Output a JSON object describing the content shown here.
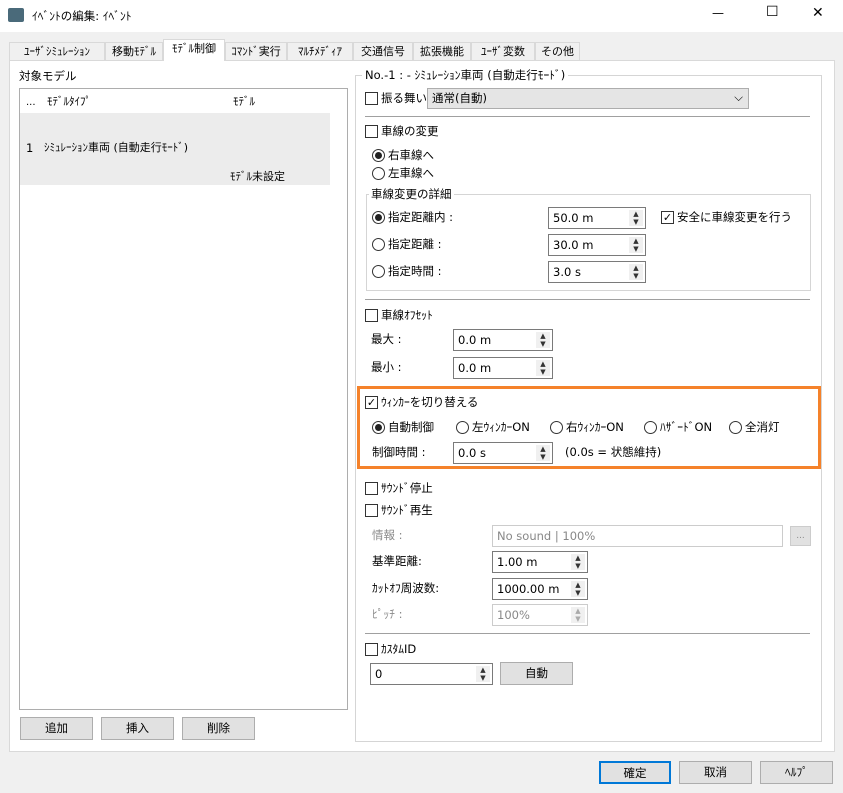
{
  "window": {
    "title": "ｲﾍﾞﾝﾄの編集: ｲﾍﾞﾝﾄ",
    "minimize": "—",
    "maximize": "☐",
    "close": "✕"
  },
  "tabs": [
    "ﾕｰｻﾞｼﾐｭﾚｰｼｮﾝ",
    "移動ﾓﾃﾞﾙ",
    "ﾓﾃﾞﾙ制御",
    "ｺﾏﾝﾄﾞ実行",
    "ﾏﾙﾁﾒﾃﾞｨｱ",
    "交通信号",
    "拡張機能",
    "ﾕｰｻﾞ変数",
    "その他"
  ],
  "active_tab": "ﾓﾃﾞﾙ制御",
  "left": {
    "label": "対象モデル",
    "columns": [
      "...",
      "ﾓﾃﾞﾙﾀｲﾌﾟ",
      "ﾓﾃﾞﾙ"
    ],
    "rows": [
      {
        "no": "1",
        "type": "ｼﾐｭﾚｰｼｮﾝ車両 (自動走行ﾓｰﾄﾞ)",
        "model": "ﾓﾃﾞﾙ未設定"
      }
    ],
    "buttons": {
      "add": "追加",
      "insert": "挿入",
      "delete": "削除"
    }
  },
  "right": {
    "group_title": "No.-1 : - ｼﾐｭﾚｰｼｮﾝ車両 (自動走行ﾓｰﾄﾞ)",
    "behavior": {
      "label": "振る舞い",
      "checked": false,
      "value": "通常(自動)"
    },
    "lane_change": {
      "label": "車線の変更",
      "checked": false,
      "right": "右車線へ",
      "left": "左車線へ",
      "selected": "right",
      "detail_title": "車線変更の詳細",
      "within_distance": "指定距離内 :",
      "within_value": "50.0 m",
      "distance": "指定距離 :",
      "distance_value": "30.0 m",
      "time": "指定時間 :",
      "time_value": "3.0 s",
      "safe": "安全に車線変更を行う",
      "safe_checked": true
    },
    "lane_offset": {
      "label": "車線ｵﾌｾｯﾄ",
      "checked": false,
      "max_label": "最大 :",
      "max_value": "0.0 m",
      "min_label": "最小 :",
      "min_value": "0.0 m"
    },
    "winker": {
      "label": "ｳｨﾝｶｰを切り替える",
      "checked": true,
      "options": [
        "自動制御",
        "左ｳｨﾝｶｰON",
        "右ｳｨﾝｶｰON",
        "ﾊｻﾞｰﾄﾞON",
        "全消灯"
      ],
      "selected": 0,
      "time_label": "制御時間 :",
      "time_value": "0.0 s",
      "note": "(0.0s = 状態維持)",
      "highlight_color": "#f5822a"
    },
    "sound_stop": {
      "label": "ｻｳﾝﾄﾞ停止",
      "checked": false
    },
    "sound_play": {
      "label": "ｻｳﾝﾄﾞ再生",
      "checked": false,
      "info_label": "情報 :",
      "info_value": "No sound | 100%",
      "browse": "...",
      "ref_label": "基準距離:",
      "ref_value": "1.00 m",
      "cutoff_label": "ｶｯﾄｵﾌ周波数:",
      "cutoff_value": "1000.00 m",
      "pitch_label": "ﾋﾟｯﾁ :",
      "pitch_value": "100%"
    },
    "custom_id": {
      "label": "ｶｽﾀﾑID",
      "checked": false,
      "value": "0",
      "auto": "自動"
    }
  },
  "footer": {
    "ok": "確定",
    "cancel": "取消",
    "help": "ﾍﾙﾌﾟ"
  }
}
